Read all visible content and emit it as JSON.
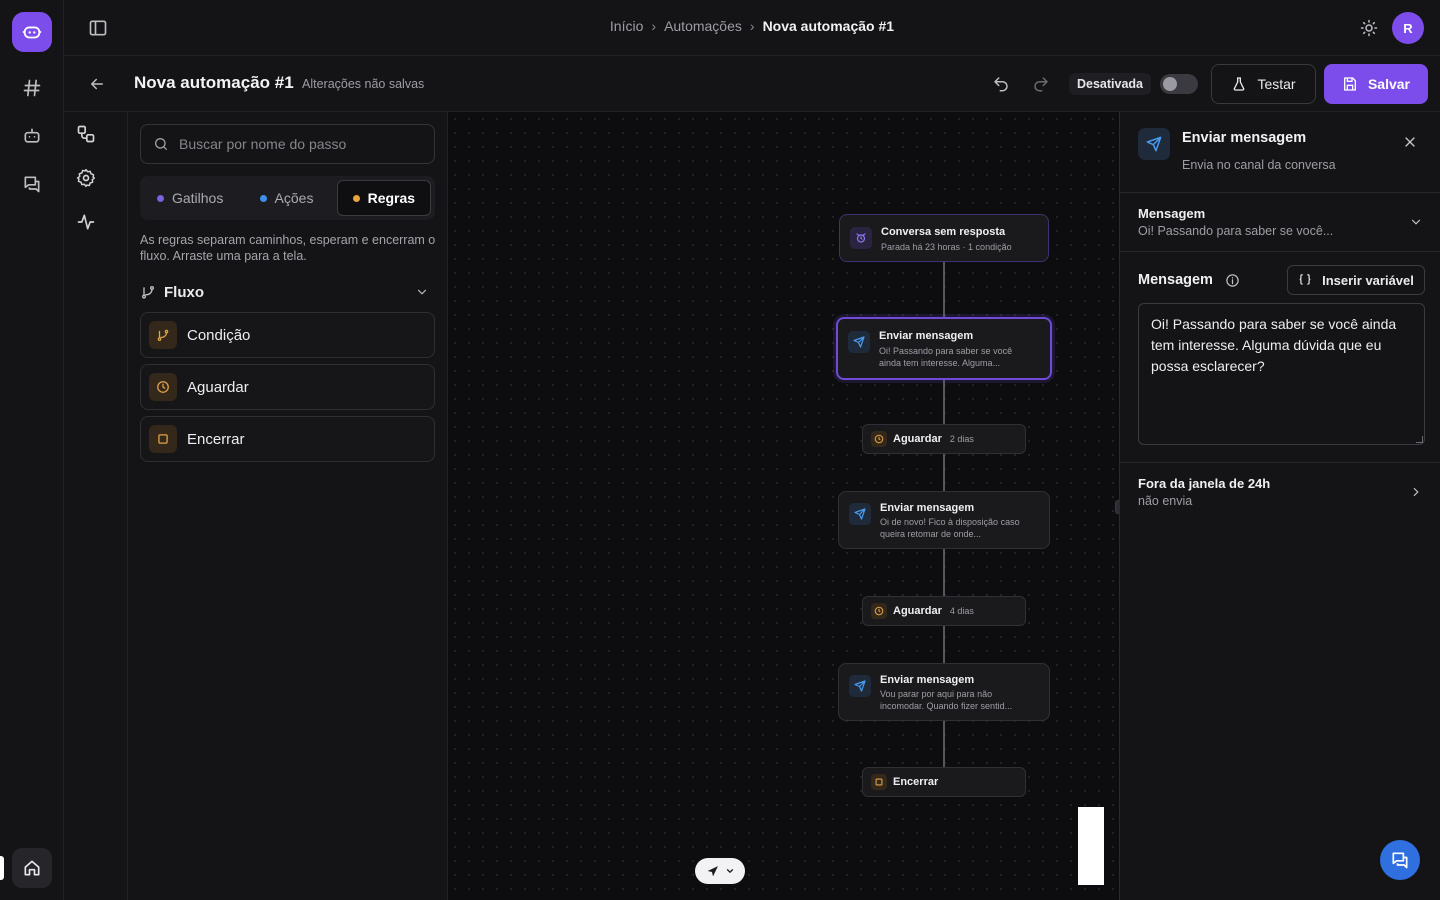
{
  "app": {
    "avatar_initial": "R",
    "accent": "#7c4dea"
  },
  "breadcrumb": [
    "Início",
    "Automações",
    "Nova automação #1"
  ],
  "header": {
    "title": "Nova automação #1",
    "unsaved": "Alterações não salvas",
    "status": "Desativada",
    "active": false,
    "test_label": "Testar",
    "save_label": "Salvar"
  },
  "panel": {
    "search_placeholder": "Buscar por nome do passo",
    "tabs": [
      {
        "label": "Gatilhos",
        "color": "#7b61e0",
        "active": false
      },
      {
        "label": "Ações",
        "color": "#3f8fe8",
        "active": false
      },
      {
        "label": "Regras",
        "color": "#e8a33d",
        "active": true
      }
    ],
    "description": "As regras separam caminhos, esperam e encerram o fluxo. Arraste uma para a tela.",
    "section_title": "Fluxo",
    "items": [
      "Condição",
      "Aguardar",
      "Encerrar"
    ]
  },
  "canvas": {
    "trigger": {
      "title": "Conversa sem resposta",
      "sub": "Parada há 23 horas · 1 condição"
    },
    "send1": {
      "title": "Enviar mensagem",
      "sub": "Oi! Passando para saber se você ainda tem interesse. Alguma..."
    },
    "wait1": {
      "title": "Aguardar",
      "sub": "2 dias"
    },
    "send2": {
      "title": "Enviar mensagem",
      "sub": "Oi de novo! Fico à disposição caso queira retomar de onde..."
    },
    "wait2": {
      "title": "Aguardar",
      "sub": "4 dias"
    },
    "send3": {
      "title": "Enviar mensagem",
      "sub": "Vou parar por aqui para não incomodar. Quando fizer sentid..."
    },
    "end": {
      "title": "Encerrar"
    }
  },
  "inspector": {
    "title": "Enviar mensagem",
    "subtitle": "Envia no canal da conversa",
    "accordion_title": "Mensagem",
    "accordion_sub": "Oi! Passando para saber se você...",
    "message_label": "Mensagem",
    "insert_variable": "Inserir variável",
    "message_text": "Oi! Passando para saber se você ainda tem interesse. Alguma dúvida que eu possa esclarecer?",
    "window_title": "Fora da janela de 24h",
    "window_sub": "não envia"
  }
}
